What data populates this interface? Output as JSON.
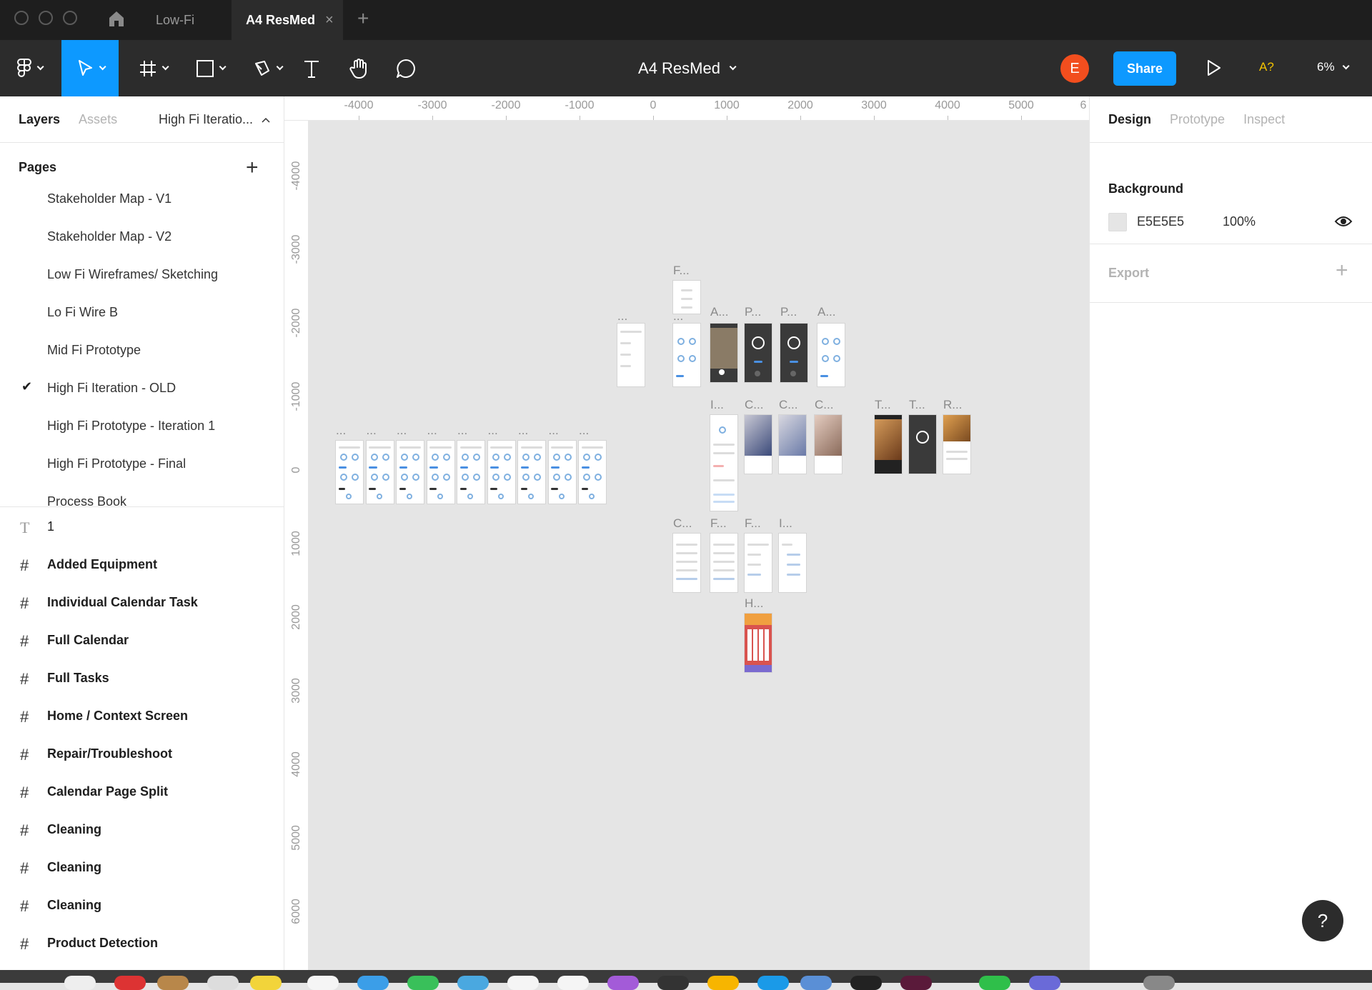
{
  "titlebar": {
    "tabs": [
      {
        "label": "Low-Fi"
      },
      {
        "label": "A4 ResMed",
        "close": "×"
      }
    ],
    "add_tab": "+"
  },
  "toolbar": {
    "document_title": "A4 ResMed",
    "avatar_initial": "E",
    "share_label": "Share",
    "accessibility_label": "A?",
    "zoom_label": "6%",
    "accent_color": "#0d99ff"
  },
  "left_panel": {
    "tabs": [
      "Layers",
      "Assets"
    ],
    "current_page": "High Fi Iteratio...",
    "pages_title": "Pages",
    "add_page": "+",
    "check_mark": "✔",
    "pages": [
      "Stakeholder Map - V1",
      "Stakeholder Map - V2",
      "Low Fi Wireframes/ Sketching",
      "Lo Fi Wire B",
      "Mid Fi Prototype",
      "High Fi Iteration - OLD",
      "High Fi Prototype - Iteration 1",
      "High Fi Prototype - Final",
      "Process Book"
    ],
    "selected_page_index": 5,
    "layers": [
      {
        "type": "text",
        "label": "1",
        "icon": "T"
      },
      {
        "type": "frame",
        "label": "Added Equipment",
        "icon": "#"
      },
      {
        "type": "frame",
        "label": "Individual Calendar Task",
        "icon": "#"
      },
      {
        "type": "frame",
        "label": "Full Calendar",
        "icon": "#"
      },
      {
        "type": "frame",
        "label": "Full Tasks",
        "icon": "#"
      },
      {
        "type": "frame",
        "label": "Home / Context Screen",
        "icon": "#"
      },
      {
        "type": "frame",
        "label": "Repair/Troubleshoot",
        "icon": "#"
      },
      {
        "type": "frame",
        "label": "Calendar Page Split",
        "icon": "#"
      },
      {
        "type": "frame",
        "label": "Cleaning",
        "icon": "#"
      },
      {
        "type": "frame",
        "label": "Cleaning",
        "icon": "#"
      },
      {
        "type": "frame",
        "label": "Cleaning",
        "icon": "#"
      },
      {
        "type": "frame",
        "label": "Product Detection",
        "icon": "#"
      }
    ]
  },
  "rulers": {
    "horizontal": [
      "-4000",
      "-3000",
      "-2000",
      "-1000",
      "0",
      "1000",
      "2000",
      "3000",
      "4000",
      "5000",
      "6"
    ],
    "vertical": [
      "-4000",
      "-3000",
      "-2000",
      "-1000",
      "0",
      "1000",
      "2000",
      "3000",
      "4000",
      "5000",
      "6000"
    ]
  },
  "canvas": {
    "background": "#E5E5E5",
    "row_label": "...",
    "frame_labels": {
      "f1": "...",
      "f2": "F...",
      "f3": "...",
      "f4": "A...",
      "f5": "P...",
      "f6": "P...",
      "f7": "A...",
      "f8": "I...",
      "f9": "C...",
      "f10": "C...",
      "f11": "C...",
      "f12": "T...",
      "f13": "T...",
      "f14": "R...",
      "f15": "C...",
      "f16": "F...",
      "f17": "F...",
      "f18": "I...",
      "f19": "H..."
    }
  },
  "right_panel": {
    "tabs": [
      "Design",
      "Prototype",
      "Inspect"
    ],
    "background_title": "Background",
    "background_hex": "E5E5E5",
    "background_opacity": "100%",
    "export_title": "Export",
    "export_add": "+"
  },
  "help_label": "?"
}
